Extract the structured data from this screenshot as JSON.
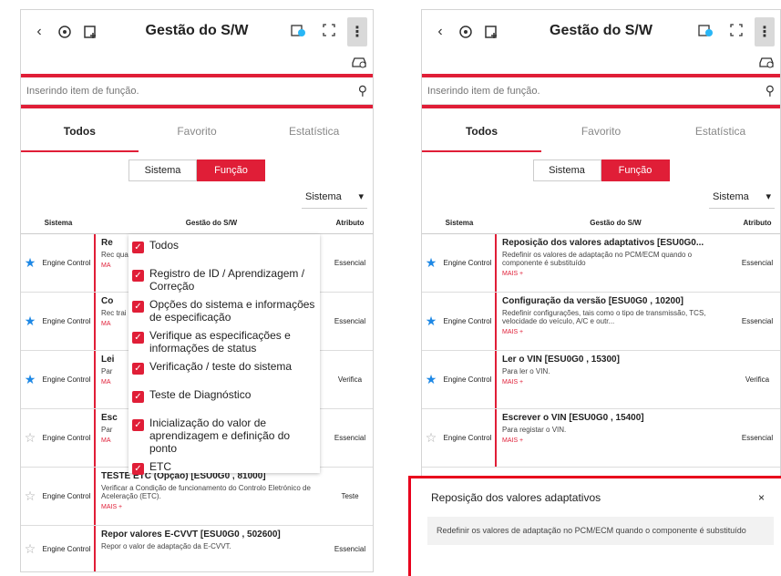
{
  "header": {
    "title": "Gestão do S/W",
    "back": "‹",
    "menu": "⋮"
  },
  "search": {
    "placeholder": "Inserindo item de função."
  },
  "tabs": [
    "Todos",
    "Favorito",
    "Estatística"
  ],
  "segment": [
    "Sistema",
    "Função"
  ],
  "dropdown": {
    "value": "Sistema"
  },
  "columns": [
    "Sistema",
    "Gestão do S/W",
    "Atributo"
  ],
  "left_rows": [
    {
      "starred": true,
      "system": "Engine Control",
      "title": "Re",
      "desc": "Rec qua",
      "more": "MA",
      "attr": "Essencial"
    },
    {
      "starred": true,
      "system": "Engine Control",
      "title": "Co",
      "desc": "Rec trai",
      "more": "MA",
      "attr": "Essencial"
    },
    {
      "starred": true,
      "system": "Engine Control",
      "title": "Lei",
      "desc": "Par",
      "more": "MA",
      "attr": "Verifica"
    },
    {
      "starred": false,
      "system": "Engine Control",
      "title": "Esc",
      "desc": "Par",
      "more": "MA",
      "attr": "Essencial"
    },
    {
      "starred": false,
      "system": "Engine Control",
      "title": "TESTE ETC (Opção) [ESU0G0 , 81000]",
      "desc": "Verificar a Condição de funcionamento do Controlo Eletrónico de Aceleração (ETC).",
      "more": "MAIS +",
      "attr": "Teste"
    },
    {
      "starred": false,
      "system": "Engine Control",
      "title": "Repor valores E-CVVT [ESU0G0 , 502600]",
      "desc": "Repor o valor de adaptação da E-CVVT.",
      "more": "",
      "attr": "Essencial"
    }
  ],
  "filter_items": [
    "Todos",
    "Registro de ID / Aprendizagem / Correção",
    "Opções do sistema e informações de especificação",
    "Verifique as especificações e informações de status",
    "Verificação / teste do sistema",
    "Teste de Diagnóstico",
    "Inicialização do valor de aprendizagem e definição do ponto",
    "ETC"
  ],
  "right_rows": [
    {
      "starred": true,
      "system": "Engine Control",
      "title": "Reposição dos valores adaptativos [ESU0G0...",
      "desc": "Redefinir os valores de adaptação no PCM/ECM quando o componente é substituído",
      "more": "MAIS +",
      "attr": "Essencial"
    },
    {
      "starred": true,
      "system": "Engine Control",
      "title": "Configuração da versão [ESU0G0 , 10200]",
      "desc": "Redefinir configurações, tais como o tipo de transmissão, TCS, velocidade do veículo, A/C e outr...",
      "more": "MAIS +",
      "attr": "Essencial"
    },
    {
      "starred": true,
      "system": "Engine Control",
      "title": "Ler o VIN [ESU0G0 , 15300]",
      "desc": "Para ler o VIN.",
      "more": "MAIS +",
      "attr": "Verifica"
    },
    {
      "starred": false,
      "system": "Engine Control",
      "title": "Escrever o VIN [ESU0G0 , 15400]",
      "desc": "Para registar o VIN.",
      "more": "MAIS +",
      "attr": "Essencial"
    }
  ],
  "sheet": {
    "title": "Reposição dos valores adaptativos",
    "close": "×",
    "desc": "Redefinir os valores de adaptação no PCM/ECM quando o componente é substituído"
  },
  "colors": {
    "accent": "#e01e37",
    "star": "#1e88e5"
  }
}
